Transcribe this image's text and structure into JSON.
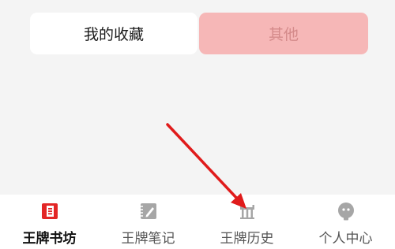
{
  "segment_tabs": {
    "left_label": "我的收藏",
    "right_label": "其他"
  },
  "bottom_nav": {
    "items": [
      {
        "label": "王牌书坊",
        "icon": "book-icon"
      },
      {
        "label": "王牌笔记",
        "icon": "notebook-pencil-icon"
      },
      {
        "label": "王牌历史",
        "icon": "history-building-icon"
      },
      {
        "label": "个人中心",
        "icon": "user-profile-icon"
      }
    ]
  },
  "colors": {
    "accent_red": "#e32626",
    "segment_selected_bg": "#f6b7b7",
    "page_bg": "#f4f4f4",
    "annotation_arrow": "#e01b1b"
  }
}
